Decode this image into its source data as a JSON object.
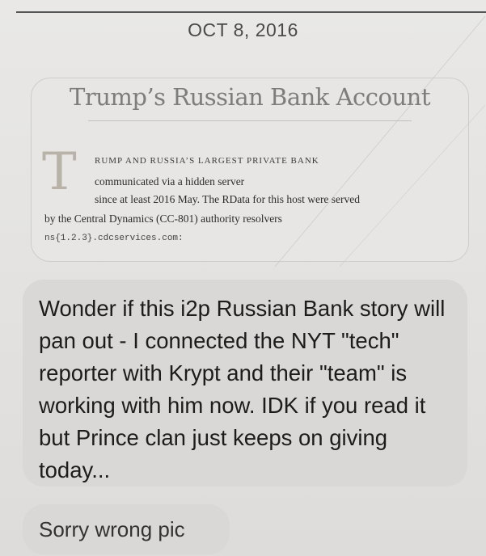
{
  "timestamp": "OCT 8, 2016",
  "link_preview": {
    "title": "Trump’s Russian Bank Account",
    "dropcap": "T",
    "lede_caps": "RUMP AND RUSSIA’S LARGEST PRIVATE BANK",
    "lede_line_2": "communicated via a hidden server",
    "lede_line_3": "since at least 2016 May.  The RData for this host were served",
    "lede_line_4": "by the Central Dynamics (CC-801) authority resolvers",
    "host": "ns{1.2.3}.cdcservices.com:"
  },
  "messages": [
    {
      "text": "Wonder if this i2p Russian Bank story will pan out - I connected the NYT \"tech\" reporter with Krypt and their \"team\" is working with him now. IDK if you read it but Prince clan just keeps on giving today..."
    },
    {
      "text": "Sorry wrong pic"
    }
  ]
}
